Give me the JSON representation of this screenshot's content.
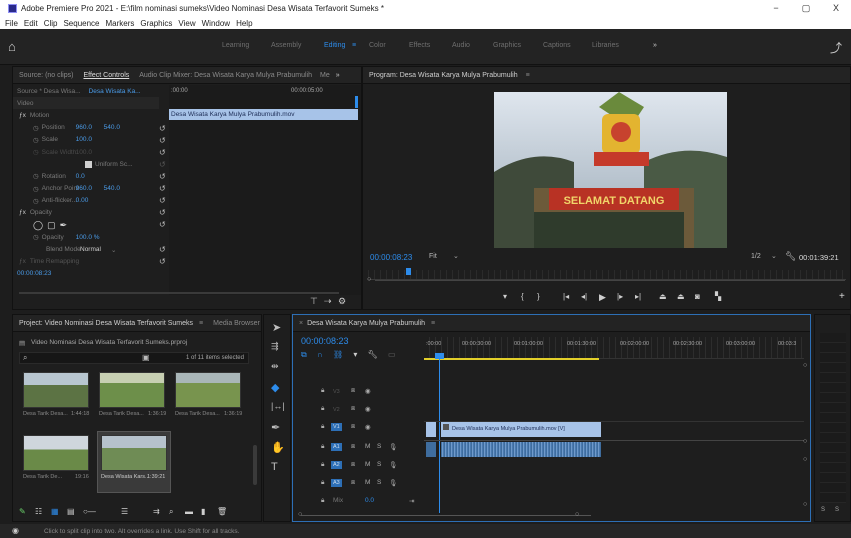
{
  "titlebar": {
    "title": "Adobe Premiere Pro 2021 - E:\\film nominasi sumeks\\Video Nominasi Desa Wisata Terfavorit Sumeks *",
    "minimize": "−",
    "maximize": "▢",
    "close": "X"
  },
  "menubar": [
    "File",
    "Edit",
    "Clip",
    "Sequence",
    "Markers",
    "Graphics",
    "View",
    "Window",
    "Help"
  ],
  "workspaces": [
    "Learning",
    "Assembly",
    "Editing",
    "Color",
    "Effects",
    "Audio",
    "Graphics",
    "Captions",
    "Libraries"
  ],
  "workspace_active_marker": "≡",
  "workspace_more": "»",
  "source_panel": {
    "tabs": [
      "Source: (no clips)",
      "Effect Controls",
      "Audio Clip Mixer: Desa Wisata Karya Mulya Prabumulih",
      "Me",
      "»"
    ],
    "source_line": "Source * Desa Wisa...",
    "sequence_line": "Desa Wisata Ka...",
    "time_start": ":00:00",
    "time_end": "00:00:05:00",
    "clip_name": "Desa Wisata Karya Mulya Prabumulih.mov",
    "timecode": "00:00:08:23",
    "rows": {
      "video": "Video",
      "motion": "Motion",
      "position_label": "Position",
      "position_x": "960.0",
      "position_y": "540.0",
      "scale_label": "Scale",
      "scale_val": "100.0",
      "scale_width_label": "Scale Width",
      "scale_width_val": "100.0",
      "uniform_label": "Uniform Sc...",
      "rotation_label": "Rotation",
      "rotation_val": "0.0",
      "anchor_label": "Anchor Point",
      "anchor_x": "960.0",
      "anchor_y": "540.0",
      "antiflicker_label": "Anti-flicker...",
      "antiflicker_val": "0.00",
      "opacity_section": "Opacity",
      "opacity_label": "Opacity",
      "opacity_val": "100.0 %",
      "blend_label": "Blend Mode",
      "blend_val": "Normal",
      "time_remap": "Time Remapping"
    }
  },
  "program_panel": {
    "title": "Program: Desa Wisata Karya Mulya Prabumulih",
    "menu_icon": "≡",
    "timecode": "00:00:08:23",
    "fit": "Fit",
    "quality": "1/2",
    "duration": "00:01:39:21",
    "sign_text": "SELAMAT DATANG"
  },
  "project_panel": {
    "title": "Project: Video Nominasi Desa Wisata Terfavorit Sumeks",
    "media_browser": "Media Browser",
    "more": "»",
    "file": "Video Nominasi Desa Wisata Terfavorit Sumeks.prproj",
    "items_selected": "1 of 11 items selected",
    "thumbs": [
      {
        "name": "Desa Tarik Desa...",
        "dur": "1:44:18"
      },
      {
        "name": "Desa Tarik Desa...",
        "dur": "1:36:19"
      },
      {
        "name": "Desa Tarik Desa...",
        "dur": "1:36:19"
      },
      {
        "name": "Desa Tarik De...",
        "dur": "19:16"
      },
      {
        "name": "Desa Wisata Kars...",
        "dur": "1:39:21"
      }
    ]
  },
  "timeline": {
    "title": "Desa Wisata Karya Mulya Prabumulih",
    "timecode": "00:00:08:23",
    "ruler": [
      ":00:00",
      "00:00:30:00",
      "00:01:00:00",
      "00:01:30:00",
      "00:02:00:00",
      "00:02:30:00",
      "00:03:00:00",
      "00:03:3"
    ],
    "video_tracks": [
      "V3",
      "V2",
      "V1"
    ],
    "audio_tracks": [
      "A1",
      "A2",
      "A3"
    ],
    "mix_label": "Mix",
    "mix_val": "0.0",
    "video_clip": "Desa Wisata Karya Mulya Prabumulih.mov [V]",
    "meter_labels": [
      "S",
      "S"
    ]
  },
  "status": {
    "text": "Click to split clip into two. Alt overrides a link. Use Shift for all tracks."
  },
  "colors": {
    "accent": "#2d8ceb",
    "clip": "#a7c3e8",
    "audio_clip": "#3f6d9e"
  }
}
